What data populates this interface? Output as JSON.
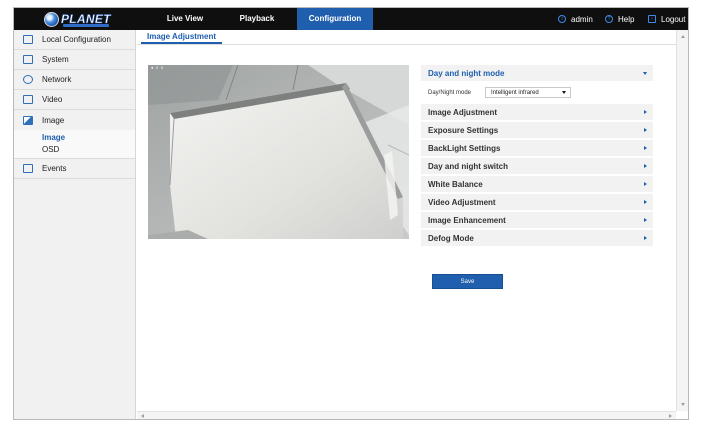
{
  "header": {
    "logo_text": "PLANET",
    "nav_tabs": [
      {
        "label": "Live View"
      },
      {
        "label": "Playback"
      },
      {
        "label": "Configuration"
      }
    ],
    "active_tab": "Configuration",
    "user": "admin",
    "help": "Help",
    "logout": "Logout",
    "accent_color": "#1f5fae",
    "bar_color": "#0f0f0f"
  },
  "sidebar": {
    "items": [
      {
        "label": "Local Configuration",
        "icon": "monitor-icon"
      },
      {
        "label": "System",
        "icon": "system-icon"
      },
      {
        "label": "Network",
        "icon": "globe-icon"
      },
      {
        "label": "Video",
        "icon": "video-icon"
      },
      {
        "label": "Image",
        "icon": "image-icon"
      },
      {
        "label": "Events",
        "icon": "events-icon"
      }
    ],
    "image_subitems": [
      {
        "label": "Image",
        "active": true
      },
      {
        "label": "OSD",
        "active": false
      }
    ]
  },
  "content": {
    "tab_label": "Image Adjustment",
    "video_tag": "♦ 2 3",
    "day_night": {
      "title": "Day and night mode",
      "field_label": "Day/Night mode",
      "field_value": "Intelligent infrared"
    },
    "sections": [
      {
        "label": "Image Adjustment"
      },
      {
        "label": "Exposure Settings"
      },
      {
        "label": "BackLight Settings"
      },
      {
        "label": "Day and night switch"
      },
      {
        "label": "White Balance"
      },
      {
        "label": "Video Adjustment"
      },
      {
        "label": "Image Enhancement"
      },
      {
        "label": "Defog Mode"
      }
    ],
    "save_label": "Save"
  }
}
